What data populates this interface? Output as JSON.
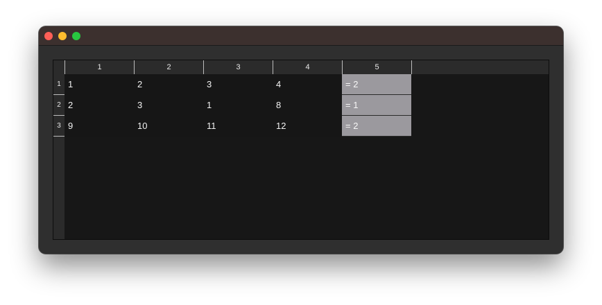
{
  "window": {
    "controls": [
      "close",
      "minimize",
      "maximize"
    ]
  },
  "spreadsheet": {
    "column_headers": [
      "1",
      "2",
      "3",
      "4",
      "5"
    ],
    "row_headers": [
      "1",
      "2",
      "3"
    ],
    "rows": [
      [
        "1",
        "2",
        "3",
        "4",
        "= 2"
      ],
      [
        "2",
        "3",
        "1",
        "8",
        "= 1"
      ],
      [
        "9",
        "10",
        "11",
        "12",
        "= 2"
      ]
    ],
    "colors": {
      "formula_cell": "#9b999e",
      "grid_background": "#171717",
      "titlebar": "#3c302e"
    }
  }
}
